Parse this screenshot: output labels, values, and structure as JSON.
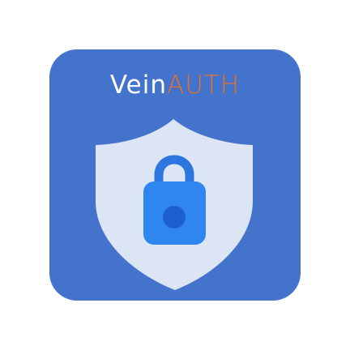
{
  "logo": {
    "brand_part1": "Vein",
    "brand_part2": "AUTH"
  },
  "colors": {
    "tile_background": "#4473CC",
    "brand_part1": "#FFFFFF",
    "brand_part2": "#E8702A",
    "shield_fill": "#DBE5F4",
    "lock_body": "#2F86EE",
    "lock_shackle": "#2C76E0",
    "keyhole": "#1E5FD0",
    "page_background": "#FFFFFF"
  },
  "icons": {
    "shield": "shield-icon",
    "lock": "lock-icon"
  }
}
